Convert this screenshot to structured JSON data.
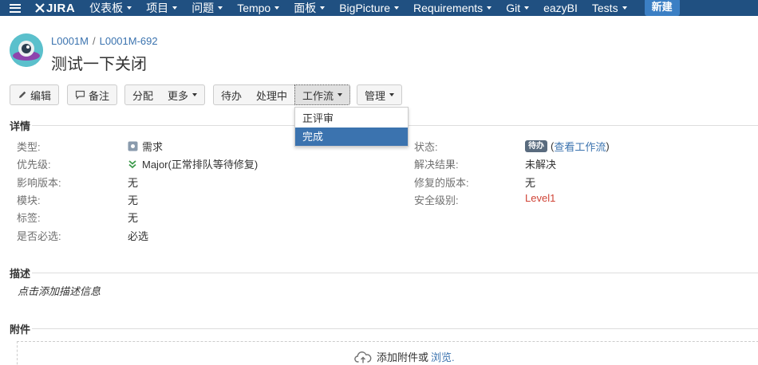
{
  "nav": {
    "logo": "JIRA",
    "items": [
      "仪表板",
      "项目",
      "问题",
      "Tempo",
      "面板",
      "BigPicture",
      "Requirements",
      "Git",
      "eazyBI",
      "Tests"
    ],
    "create": "新建"
  },
  "breadcrumb": {
    "project": "L0001M",
    "sep": "/",
    "issue": "L0001M-692"
  },
  "title": "测试一下关闭",
  "toolbar": {
    "edit": "编辑",
    "comment": "备注",
    "assign": "分配",
    "more": "更多",
    "todo": "待办",
    "in_progress": "处理中",
    "workflow": "工作流",
    "admin": "管理"
  },
  "dropdown": {
    "items": [
      "正评审",
      "完成"
    ]
  },
  "details": {
    "heading": "详情",
    "type_label": "类型:",
    "type_value": "需求",
    "priority_label": "优先级:",
    "priority_value": "Major(正常排队等待修复)",
    "affects_label": "影响版本:",
    "affects_value": "无",
    "component_label": "模块:",
    "component_value": "无",
    "labels_label": "标签:",
    "labels_value": "无",
    "required_label": "是否必选:",
    "required_value": "必选",
    "status_label": "状态:",
    "status_badge": "待办",
    "status_link_open": "(",
    "status_link": "查看工作流",
    "status_link_close": ")",
    "resolution_label": "解决结果:",
    "resolution_value": "未解决",
    "fix_label": "修复的版本:",
    "fix_value": "无",
    "security_label": "安全级别:",
    "security_value": "Level1"
  },
  "description": {
    "heading": "描述",
    "hint": "点击添加描述信息"
  },
  "attachments": {
    "heading": "附件",
    "text": "添加附件或",
    "browse": "浏览."
  },
  "colors": {
    "nav_bg": "#205081",
    "link": "#3b73af",
    "create_btn": "#3b7fc4",
    "security_red": "#d04437",
    "selected_bg": "#3b73af"
  }
}
